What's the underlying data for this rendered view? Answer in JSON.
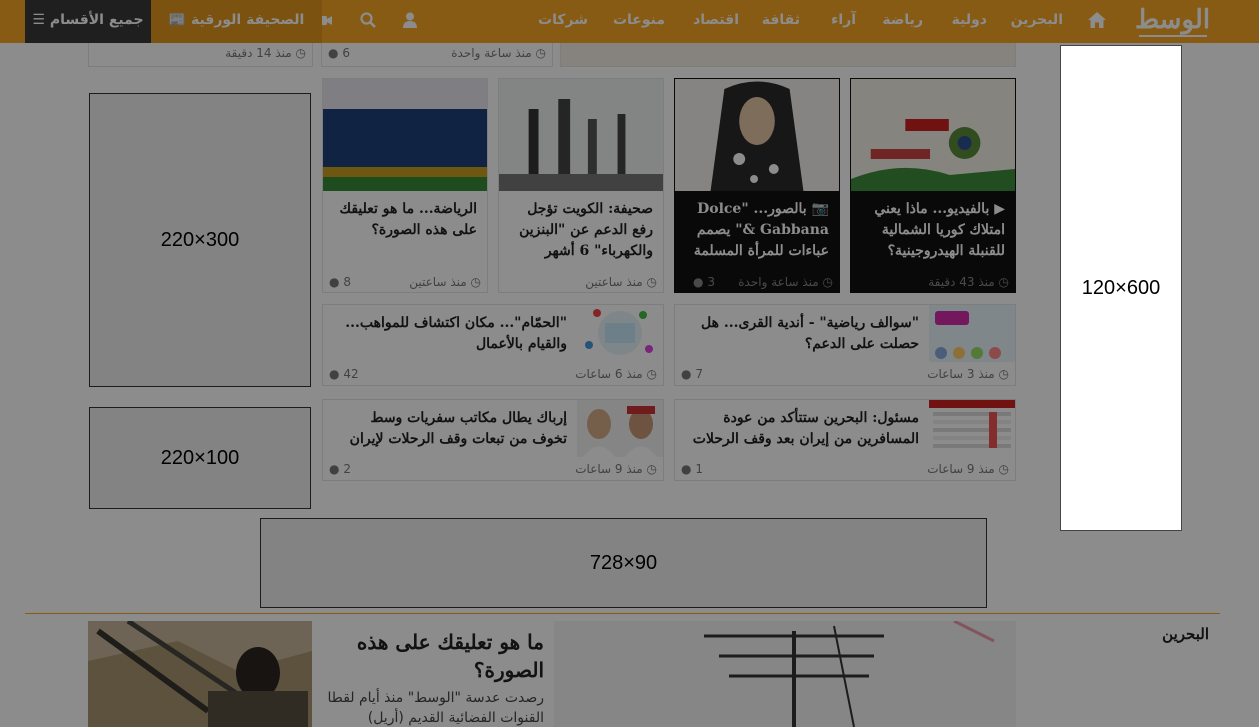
{
  "nav": {
    "logo": "الوسط",
    "links": [
      "البحرين",
      "دولية",
      "رياضة",
      "آراء",
      "ثقافة",
      "اقتصاد",
      "منوعات",
      "شركات"
    ],
    "paper_label": "الصحيفة الورقية",
    "sections_label": "جميع الأقسام"
  },
  "top_strip": {
    "left": {
      "time": "منذ 14 دقيقة"
    },
    "mid": {
      "time": "منذ ساعة واحدة",
      "comments": "6"
    }
  },
  "cards": [
    {
      "title": "بالفيديو... ماذا يعني امتلاك كوريا الشمالية للقنبلة الهيدروجينية؟",
      "time": "منذ 43 دقيقة",
      "comments": "",
      "icon": "video-icon",
      "dark": true
    },
    {
      "title": "بالصور... \"Dolce & Gabbana\" يصمم عباءات للمرأة المسلمة",
      "time": "منذ ساعة واحدة",
      "comments": "3",
      "icon": "camera-icon",
      "dark": true
    },
    {
      "title": "صحيفة: الكويت تؤجل رفع الدعم عن \"البنزين والكهرباء\" 6 أشهر",
      "time": "منذ ساعتين",
      "comments": "",
      "icon": "",
      "dark": false
    },
    {
      "title": "الرياضة... ما هو تعليقك على هذه الصورة؟",
      "time": "منذ ساعتين",
      "comments": "8",
      "icon": "",
      "dark": false
    }
  ],
  "rows": [
    {
      "title": "\"سوالف رياضية\" - أندية القرى... هل حصلت على الدعم؟",
      "time": "منذ 3 ساعات",
      "comments": "7"
    },
    {
      "title": "\"الحمّام\"... مكان اكتشاف للمواهب... والقيام بالأعمال",
      "time": "منذ 6 ساعات",
      "comments": "42"
    },
    {
      "title": "مسئول: البحرين ستتأكد من عودة المسافرين من إيران بعد وقف الرحلات",
      "time": "منذ 9 ساعات",
      "comments": "1"
    },
    {
      "title": "إرباك يطال مكاتب سفريات وسط تخوف من تبعات وقف الرحلات لإيران",
      "time": "منذ 9 ساعات",
      "comments": "2"
    }
  ],
  "ads": {
    "a1": "220×300",
    "a2": "220×100",
    "a3": "728×90",
    "a4": "120×600"
  },
  "bottom": {
    "section": "البحرين",
    "title": "ما هو تعليقك على هذه الصورة؟",
    "desc": "رصدت عدسة \"الوسط\" منذ أيام لقطا القنوات الفضائية القديم (أريل)"
  },
  "colors": {
    "accent": "#f6a623",
    "dark": "#3a3a3a"
  }
}
